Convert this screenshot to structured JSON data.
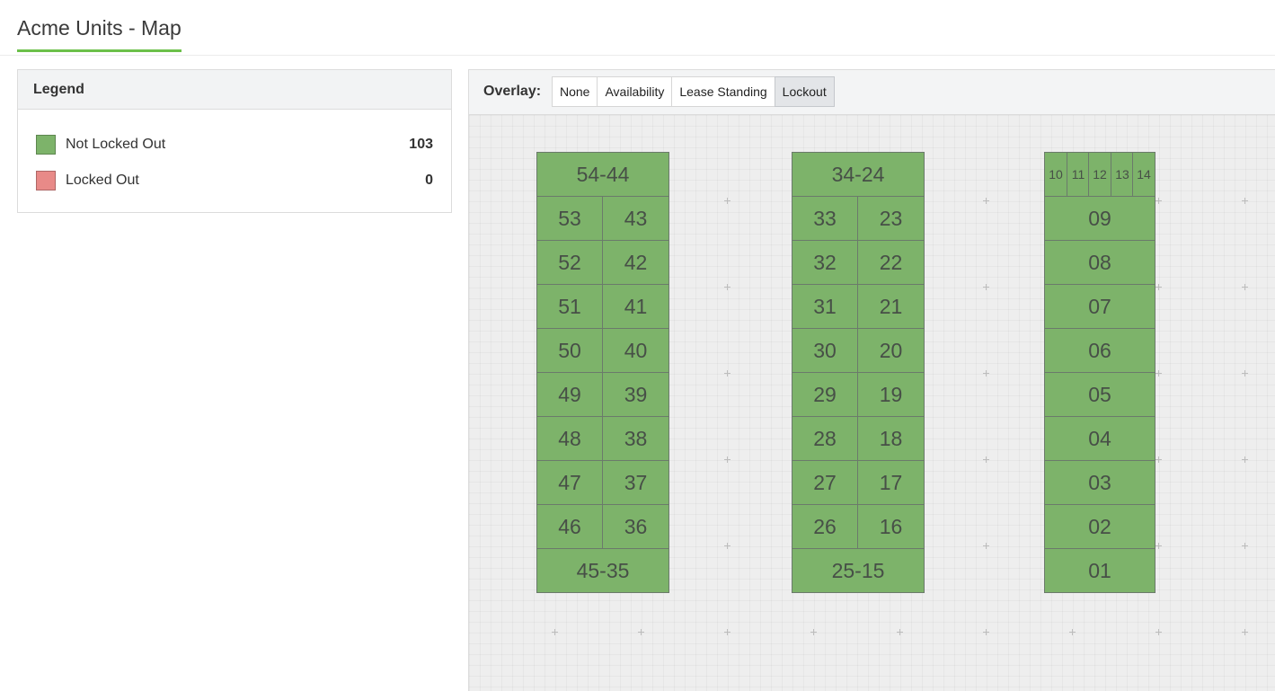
{
  "page": {
    "title": "Acme Units - Map"
  },
  "legend": {
    "title": "Legend",
    "items": [
      {
        "label": "Not Locked Out",
        "count": "103",
        "color": "#7db36a"
      },
      {
        "label": "Locked Out",
        "count": "0",
        "color": "#e88a88"
      }
    ]
  },
  "toolbar": {
    "overlay_label": "Overlay:",
    "buttons": [
      {
        "label": "None",
        "active": false
      },
      {
        "label": "Availability",
        "active": false
      },
      {
        "label": "Lease Standing",
        "active": false
      },
      {
        "label": "Lockout",
        "active": true
      }
    ]
  },
  "map": {
    "unit_color": "#7db36a",
    "buildings": [
      {
        "top_label": "54-44",
        "left_column": [
          "53",
          "52",
          "51",
          "50",
          "49",
          "48",
          "47",
          "46"
        ],
        "right_column": [
          "43",
          "42",
          "41",
          "40",
          "39",
          "38",
          "37",
          "36"
        ],
        "bottom_label": "45-35"
      },
      {
        "top_label": "34-24",
        "left_column": [
          "33",
          "32",
          "31",
          "30",
          "29",
          "28",
          "27",
          "26"
        ],
        "right_column": [
          "23",
          "22",
          "21",
          "20",
          "19",
          "18",
          "17",
          "16"
        ],
        "bottom_label": "25-15"
      },
      {
        "top_row": [
          "10",
          "11",
          "12",
          "13",
          "14"
        ],
        "stack": [
          "09",
          "08",
          "07",
          "06",
          "05",
          "04",
          "03",
          "02",
          "01"
        ]
      }
    ]
  }
}
